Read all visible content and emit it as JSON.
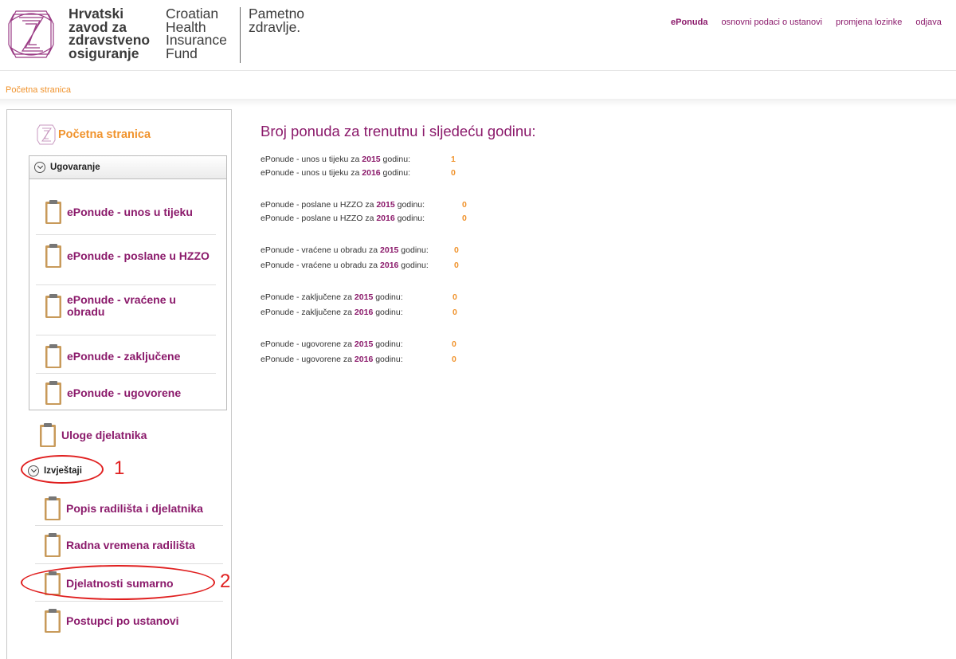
{
  "logo": {
    "hr_lines": [
      "Hrvatski",
      "zavod za",
      "zdravstveno",
      "osiguranje"
    ],
    "en_lines": [
      "Croatian",
      "Health",
      "Insurance",
      "Fund"
    ],
    "slogan_lines": [
      "Pametno",
      "zdravlje."
    ]
  },
  "topnav": [
    "ePonuda",
    "osnovni podaci o ustanovi",
    "promjena lozinke",
    "odjava"
  ],
  "breadcrumb": "Početna stranica",
  "sidebar": {
    "home_label": "Početna stranica",
    "ugovaranje_label": "Ugovaranje",
    "ugovaranje_items": [
      "ePonude - unos u tijeku",
      "ePonude - poslane u HZZO",
      "ePonude - vraćene u obradu",
      "ePonude - zaključene",
      "ePonude - ugovorene"
    ],
    "uloge_label": "Uloge djelatnika",
    "izvjestaji_label": "Izvještaji",
    "izvjestaji_items": [
      "Popis radilišta i djelatnika",
      "Radna vremena radilišta",
      "Djelatnosti sumarno",
      "Postupci po ustanovi"
    ]
  },
  "annotations": [
    "1",
    "2"
  ],
  "content": {
    "title": "Broj ponuda za trenutnu i sljedeću godinu:",
    "groups": [
      {
        "rows": [
          {
            "prefix": "ePonude - unos u tijeku za ",
            "year": "2015",
            "suffix": " godinu:",
            "value": "1"
          },
          {
            "prefix": "ePonude - unos u tijeku za ",
            "year": "2016",
            "suffix": " godinu:",
            "value": "0"
          }
        ]
      },
      {
        "rows": [
          {
            "prefix": "ePonude - poslane u HZZO za ",
            "year": "2015",
            "suffix": " godinu:",
            "value": "0"
          },
          {
            "prefix": "ePonude - poslane u HZZO za ",
            "year": "2016",
            "suffix": " godinu:",
            "value": "0"
          }
        ]
      },
      {
        "rows": [
          {
            "prefix": "ePonude - vraćene u obradu za ",
            "year": "2015",
            "suffix": " godinu:",
            "value": "0"
          },
          {
            "prefix": "ePonude - vraćene u obradu za ",
            "year": "2016",
            "suffix": " godinu:",
            "value": "0"
          }
        ]
      },
      {
        "rows": [
          {
            "prefix": "ePonude - zaključene za ",
            "year": "2015",
            "suffix": " godinu:",
            "value": "0"
          },
          {
            "prefix": "ePonude - zaključene za ",
            "year": "2016",
            "suffix": " godinu:",
            "value": "0"
          }
        ]
      },
      {
        "rows": [
          {
            "prefix": "ePonude - ugovorene za ",
            "year": "2015",
            "suffix": " godinu:",
            "value": "0"
          },
          {
            "prefix": "ePonude - ugovorene za ",
            "year": "2016",
            "suffix": " godinu:",
            "value": "0"
          }
        ]
      }
    ]
  },
  "colors": {
    "brand_purple": "#8b1a6b",
    "accent_orange": "#f0932d",
    "annotation_red": "#e02020"
  }
}
